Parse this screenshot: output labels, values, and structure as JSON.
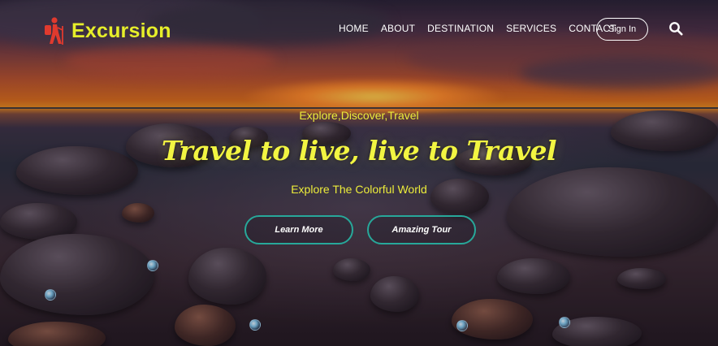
{
  "brand": {
    "name": "Excursion",
    "icon": "hiker-icon",
    "color": "#e6ee2a",
    "icon_color": "#e03a2e"
  },
  "nav": {
    "items": [
      {
        "label": "HOME"
      },
      {
        "label": "ABOUT"
      },
      {
        "label": "DESTINATION"
      },
      {
        "label": "SERVICES"
      },
      {
        "label": "CONTACT"
      }
    ],
    "signin_label": "Sign In",
    "search_icon": "search-icon"
  },
  "hero": {
    "tagline": "Explore,Discover,Travel",
    "headline": "Travel to live, live to Travel",
    "subline": "Explore The Colorful World",
    "buttons": {
      "learn_more": "Learn More",
      "amazing_tour": "Amazing Tour"
    },
    "accent_color": "#ecec3a",
    "button_border_color": "#27a89a"
  }
}
